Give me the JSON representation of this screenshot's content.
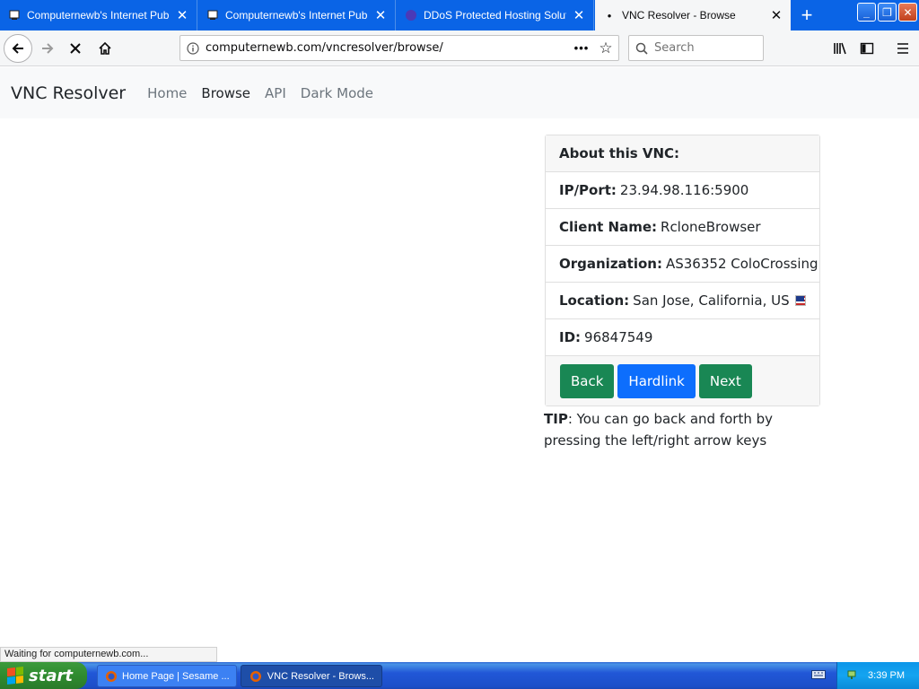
{
  "tabs": [
    {
      "title": "Computernewb's Internet Pub Hu",
      "icon": "pub-favicon-icon"
    },
    {
      "title": "Computernewb's Internet Pub Hu",
      "icon": "pub-favicon-icon"
    },
    {
      "title": "DDoS Protected Hosting Solution",
      "icon": "ddos-favicon-icon"
    },
    {
      "title": "VNC Resolver - Browse",
      "icon": "loading-dot-icon"
    }
  ],
  "browser": {
    "url": "computernewb.com/vncresolver/browse/",
    "search_placeholder": "Search"
  },
  "site": {
    "brand": "VNC Resolver",
    "nav": [
      "Home",
      "Browse",
      "API",
      "Dark Mode"
    ],
    "active_nav": "Browse"
  },
  "card": {
    "header": "About this VNC:",
    "rows": [
      {
        "label": "IP/Port:",
        "value": "23.94.98.116:5900"
      },
      {
        "label": "Client Name:",
        "value": "RcloneBrowser"
      },
      {
        "label": "Organization:",
        "value": "AS36352 ColoCrossing"
      },
      {
        "label": "Location:",
        "value": "San Jose, California, US"
      },
      {
        "label": "ID:",
        "value": "96847549"
      }
    ],
    "buttons": {
      "back": "Back",
      "hardlink": "Hardlink",
      "next": "Next"
    }
  },
  "tip": {
    "label": "TIP",
    "text": ": You can go back and forth by pressing the left/right arrow keys"
  },
  "status_text": "Waiting for computernewb.com...",
  "taskbar": {
    "start": "start",
    "items": [
      "Home Page | Sesame ...",
      "VNC Resolver - Brows..."
    ],
    "clock": "3:39 PM"
  },
  "colors": {
    "tab_strip": "#0a64e6",
    "button_green": "#198754",
    "button_blue": "#0d6efd",
    "taskbar_blue": "#2157d7"
  }
}
